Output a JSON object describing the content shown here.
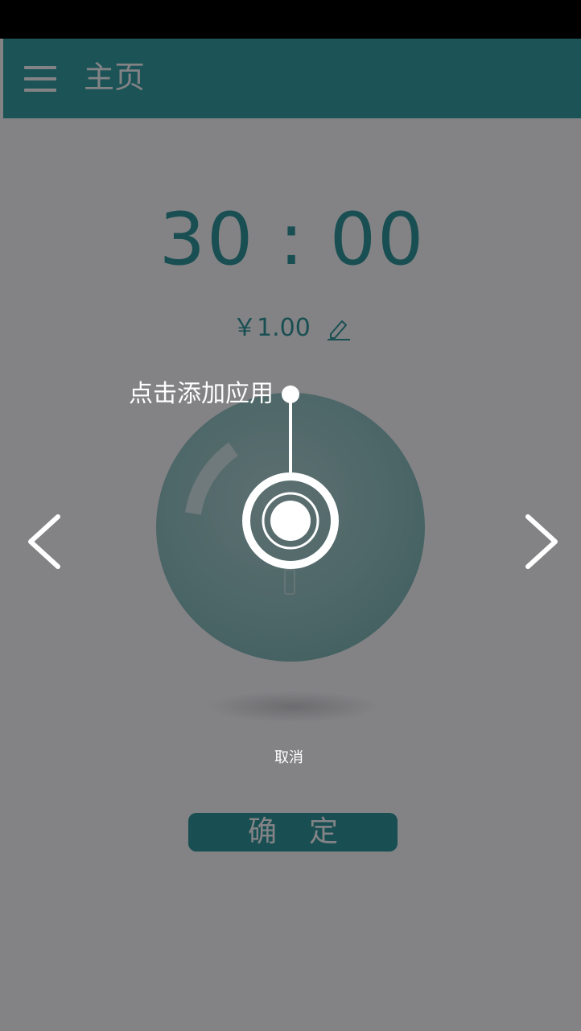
{
  "toolbar": {
    "menu_icon": "menu-icon",
    "title": "主页"
  },
  "timer": {
    "display": "30 : 00"
  },
  "price": {
    "amount": "￥1.00",
    "edit_icon": "pencil-edit-icon"
  },
  "guide": {
    "label": "点击添加应用"
  },
  "navigation": {
    "prev_icon": "chevron-left-icon",
    "next_icon": "chevron-right-icon"
  },
  "actions": {
    "cancel_icon": "close-circle-icon",
    "cancel_label": "取消",
    "confirm_label": "确定"
  },
  "colors": {
    "accent": "#2a9696",
    "toolbar": "#2f9e9e",
    "dial": "#8ec3bf",
    "status_bar": "#000000",
    "overlay": "rgba(8,8,14,0.5)"
  }
}
